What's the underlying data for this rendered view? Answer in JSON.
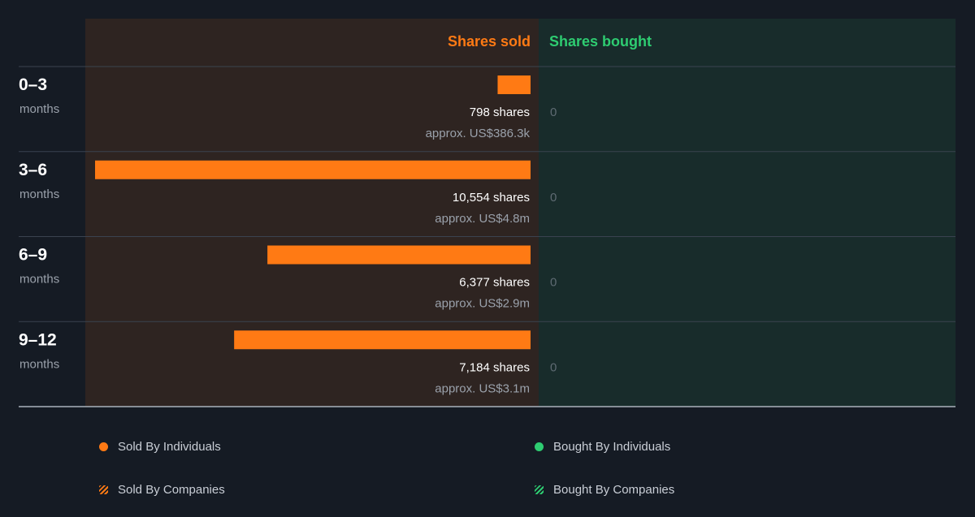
{
  "chart_data": {
    "type": "bar",
    "column_headers": {
      "sold": "Shares sold",
      "bought": "Shares bought"
    },
    "categories": [
      {
        "period": "0–3",
        "unit": "months"
      },
      {
        "period": "3–6",
        "unit": "months"
      },
      {
        "period": "6–9",
        "unit": "months"
      },
      {
        "period": "9–12",
        "unit": "months"
      }
    ],
    "series": [
      {
        "name": "Shares sold",
        "values": [
          798,
          10554,
          6377,
          7184
        ]
      },
      {
        "name": "Shares bought",
        "values": [
          0,
          0,
          0,
          0
        ]
      }
    ],
    "sold_labels": [
      "798 shares",
      "10,554 shares",
      "6,377 shares",
      "7,184 shares"
    ],
    "sold_value_labels": [
      "approx. US$386.3k",
      "approx. US$4.8m",
      "approx. US$2.9m",
      "approx. US$3.1m"
    ],
    "bought_labels": [
      "0",
      "0",
      "0",
      "0"
    ],
    "legend": [
      {
        "label": "Sold By Individuals"
      },
      {
        "label": "Sold By Companies"
      },
      {
        "label": "Bought By Individuals"
      },
      {
        "label": "Bought By Companies"
      }
    ],
    "colors": {
      "sold": "#ff7a14",
      "bought": "#2ecc71",
      "sold_panel": "#2e2421",
      "bought_panel": "#182c2b",
      "background": "#151b24"
    }
  }
}
